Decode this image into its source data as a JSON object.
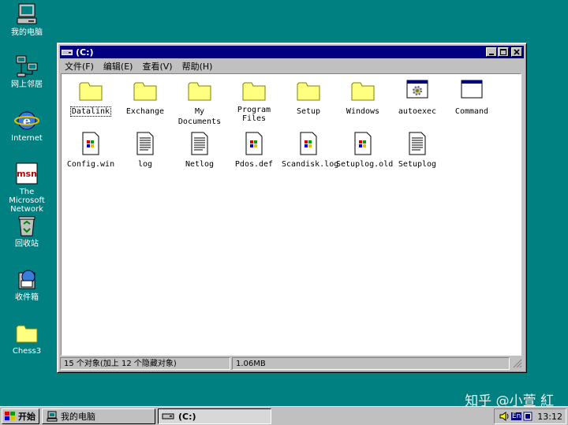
{
  "desktop": {
    "icons": [
      {
        "label": "我的电脑",
        "icon": "computer-icon"
      },
      {
        "label": "网上邻居",
        "icon": "network-icon"
      },
      {
        "label": "Internet",
        "icon": "internet-explorer-icon"
      },
      {
        "label": "The Microsoft Network",
        "icon": "msn-icon"
      },
      {
        "label": "回收站",
        "icon": "recycle-bin-icon"
      },
      {
        "label": "收件箱",
        "icon": "inbox-icon"
      },
      {
        "label": "Chess3",
        "icon": "folder-icon"
      }
    ]
  },
  "window": {
    "title": "(C:)",
    "menu": [
      "文件(F)",
      "编辑(E)",
      "查看(V)",
      "帮助(H)"
    ],
    "items": [
      {
        "label": "Datalink",
        "icon": "folder-icon"
      },
      {
        "label": "Exchange",
        "icon": "folder-icon"
      },
      {
        "label": "My Documents",
        "icon": "folder-icon"
      },
      {
        "label": "Program Files",
        "icon": "folder-icon"
      },
      {
        "label": "Setup",
        "icon": "folder-icon"
      },
      {
        "label": "Windows",
        "icon": "folder-icon"
      },
      {
        "label": "autoexec",
        "icon": "batch-file-icon"
      },
      {
        "label": "Command",
        "icon": "ms-dos-program-icon"
      },
      {
        "label": "Config.win",
        "icon": "windows-file-icon"
      },
      {
        "label": "log",
        "icon": "text-file-icon"
      },
      {
        "label": "Netlog",
        "icon": "text-file-icon"
      },
      {
        "label": "Pdos.def",
        "icon": "windows-file-icon"
      },
      {
        "label": "Scandisk.log",
        "icon": "windows-file-icon"
      },
      {
        "label": "Setuplog.old",
        "icon": "windows-file-icon"
      },
      {
        "label": "Setuplog",
        "icon": "text-file-icon"
      }
    ],
    "status": {
      "objects": "15 个对象(加上 12 个隐藏对象)",
      "size": "1.06MB"
    }
  },
  "taskbar": {
    "start_label": "开始",
    "tasks": [
      "我的电脑",
      "(C:)"
    ],
    "tray_lang": "En",
    "clock": "13:12"
  },
  "watermark": "知乎 @小萱 紅",
  "colors": {
    "desktop": "#008080",
    "title_active": "#000080",
    "chrome": "#c0c0c0",
    "folder": "#ffff80"
  }
}
